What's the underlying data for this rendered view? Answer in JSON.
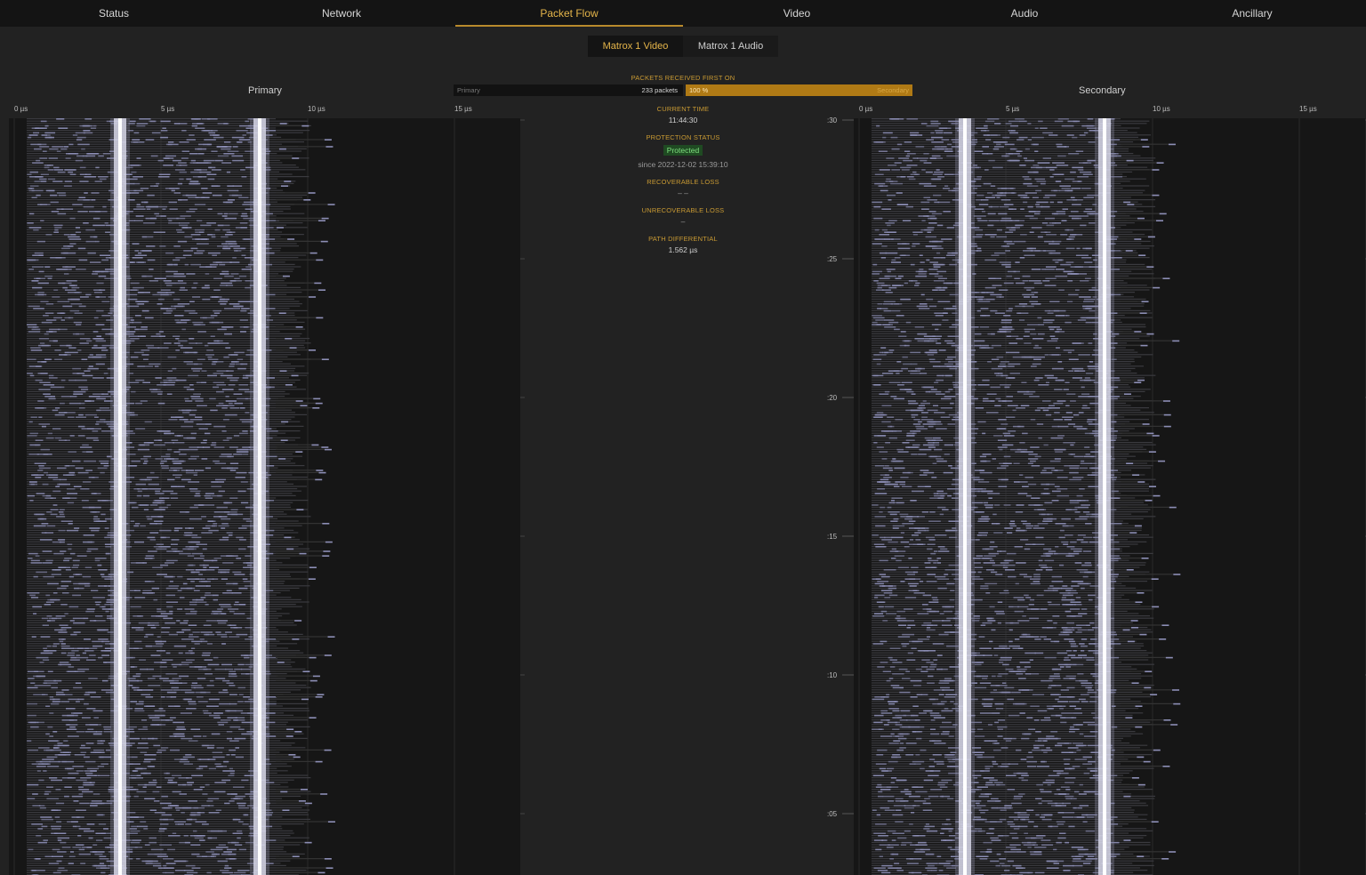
{
  "nav": {
    "tabs": [
      {
        "label": "Status"
      },
      {
        "label": "Network"
      },
      {
        "label": "Packet Flow"
      },
      {
        "label": "Video"
      },
      {
        "label": "Audio"
      },
      {
        "label": "Ancillary"
      }
    ],
    "active_tab": "Packet Flow"
  },
  "subtabs": [
    {
      "label": "Matrox 1 Video"
    },
    {
      "label": "Matrox 1 Audio"
    }
  ],
  "primary": {
    "title": "Primary",
    "x_ticks": [
      "0 µs",
      "5 µs",
      "10 µs",
      "15 µs"
    ]
  },
  "secondary": {
    "title": "Secondary",
    "x_ticks": [
      "0 µs",
      "5 µs",
      "10 µs",
      "15 µs"
    ],
    "y_ticks": [
      ":30",
      ":25",
      ":20",
      ":15",
      ":10",
      ":05"
    ]
  },
  "first_on": {
    "label": "PACKETS RECEIVED FIRST ON",
    "primary_label": "Primary",
    "primary_count": "233 packets",
    "secondary_pct": "100 %",
    "secondary_label": "Secondary"
  },
  "current_time": {
    "label": "CURRENT TIME",
    "value": "11:44:30"
  },
  "protection": {
    "label": "PROTECTION STATUS",
    "status": "Protected",
    "since": "since 2022-12-02 15:39:10"
  },
  "recoverable_loss": {
    "label": "RECOVERABLE LOSS",
    "value": "–     –"
  },
  "unrecoverable_loss": {
    "label": "UNRECOVERABLE LOSS",
    "value": "–"
  },
  "path_differential": {
    "label": "PATH DIFFERENTIAL",
    "value": "1.562 µs"
  },
  "colors": {
    "accent": "#c99a33",
    "protected_bg": "#1f4a22",
    "protected_text": "#7fe07f",
    "packet": "#8d8fb6"
  }
}
